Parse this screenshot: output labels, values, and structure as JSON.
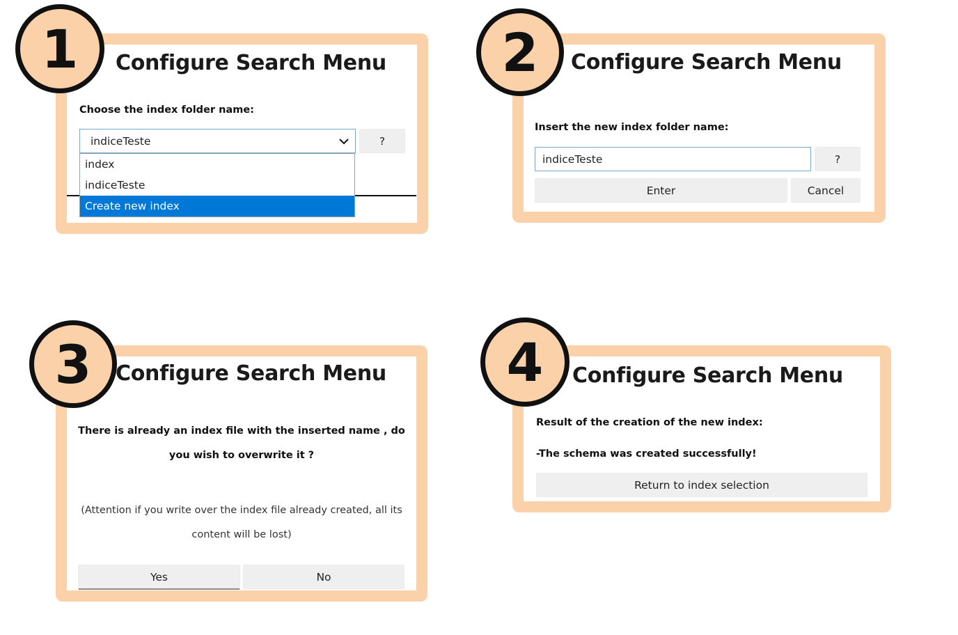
{
  "steps": [
    "1",
    "2",
    "3",
    "4"
  ],
  "panel1": {
    "title": "Configure Search Menu",
    "label": "Choose the index folder name:",
    "select_value": "indiceTeste",
    "help_label": "?",
    "options": [
      "index",
      "indiceTeste",
      "Create new index"
    ],
    "highlighted_option": "Create new index"
  },
  "panel2": {
    "title": "Configure Search Menu",
    "label": "Insert the new index folder name:",
    "input_value": "indiceTeste",
    "help_label": "?",
    "enter_label": "Enter",
    "cancel_label": "Cancel"
  },
  "panel3": {
    "title": "Configure Search Menu",
    "question_line1": "There is already an index file with the inserted name , do",
    "question_line2": "you wish to overwrite it ?",
    "warning_line1": "(Attention if you write over the index file already created, all its",
    "warning_line2": "content will be lost)",
    "yes_label": "Yes",
    "no_label": "No"
  },
  "panel4": {
    "title": "Configure Search Menu",
    "result_label": "Result of the creation of the new index:",
    "result_message": "-The schema was created successfully!",
    "return_label": "Return to index selection"
  },
  "colors": {
    "frame": "#fad1a8",
    "selected_option": "#0078d7",
    "button_bg": "#efefef"
  }
}
